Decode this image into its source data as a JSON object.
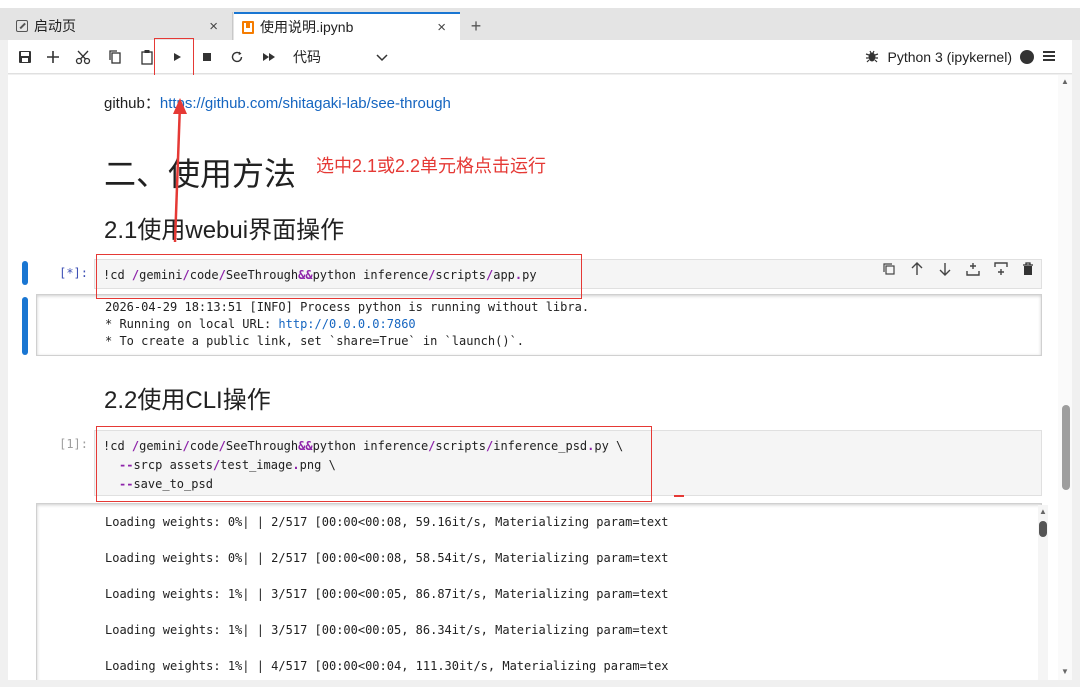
{
  "tabs": [
    {
      "label": "启动页",
      "close": "×"
    },
    {
      "label": "使用说明.ipynb",
      "close": "×"
    }
  ],
  "new_tab": "+",
  "toolbar": {
    "celltype": "代码",
    "kernel": "Python 3 (ipykernel)"
  },
  "content": {
    "github_label": "github：",
    "github_url": "https://github.com/shitagaki-lab/see-through",
    "heading_usage": "二、使用方法",
    "annotation": "选中2.1或2.2单元格点击运行",
    "heading_webui": "2.1使用webui界面操作",
    "heading_cli": "2.2使用CLI操作"
  },
  "cell1": {
    "prompt": "[*]:",
    "code": {
      "bang": "!cd ",
      "p1": "/",
      "p2": "gemini",
      "p3": "/",
      "p4": "code",
      "p5": "/",
      "p6": "SeeThrough",
      "op": "&&",
      "p7": "python inference",
      "p8": "/",
      "p9": "scripts",
      "p10": "/",
      "p11": "app",
      "p12": ".",
      "p13": "py"
    },
    "output": [
      "2026-04-29 18:13:51 [INFO] Process python is running without libra.",
      "* Running on local URL:  ",
      "* To create a public link, set `share=True` in `launch()`."
    ],
    "output_url": "http://0.0.0.0:7860"
  },
  "cell2": {
    "prompt": "[1]:",
    "line1": {
      "bang": "!cd ",
      "s1": "/",
      "t1": "gemini",
      "s2": "/",
      "t2": "code",
      "s3": "/",
      "t3": "SeeThrough",
      "op": "&&",
      "t4": "python inference",
      "s4": "/",
      "t5": "scripts",
      "s5": "/",
      "t6": "inference_psd",
      "s6": ".",
      "t7": "py",
      "t8": " \\"
    },
    "line2_flag": "--",
    "line2_rest": "srcp assets",
    "line2_slash": "/",
    "line2_file": "test_image",
    "line2_dot": ".",
    "line2_ext": "png",
    "line2_end": " \\",
    "line3_flag": "--",
    "line3_rest": "save_to_psd",
    "output": [
      "Loading weights:   0%| | 2/517 [00:00<00:08, 59.16it/s, Materializing param=text",
      "Loading weights:   0%| | 2/517 [00:00<00:08, 58.54it/s, Materializing param=text",
      "Loading weights:   1%| | 3/517 [00:00<00:05, 86.87it/s, Materializing param=text",
      "Loading weights:   1%| | 3/517 [00:00<00:05, 86.34it/s, Materializing param=text",
      "Loading weights:   1%| | 4/517 [00:00<00:04, 111.30it/s, Materializing param=tex"
    ]
  }
}
